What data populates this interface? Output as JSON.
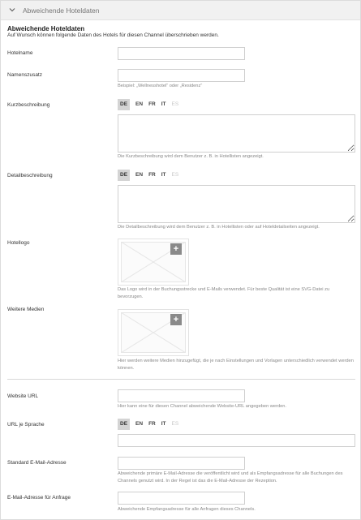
{
  "panel": {
    "title": "Abweichende Hoteldaten"
  },
  "section": {
    "title": "Abweichende Hoteldaten",
    "description": "Auf Wunsch können folgende Daten des Hotels für diesen Channel überschrieben werden."
  },
  "fields": {
    "hotelname": {
      "label": "Hotelname",
      "value": ""
    },
    "namenszusatz": {
      "label": "Namenszusatz",
      "value": "",
      "hint": "Beispiel: „Wellnesshotel“ oder „Residenz“"
    },
    "kurzbeschreibung": {
      "label": "Kurzbeschreibung",
      "hint": "Die Kurzbeschreibung wird dem Benutzer z. B. in Hotellisten angezeigt."
    },
    "detailbeschreibung": {
      "label": "Detailbeschreibung",
      "hint": "Die Detailbeschreibung wird dem Benutzer z. B. in Hotellisten oder auf Hoteldetailseiten angezeigt."
    },
    "hotellogo": {
      "label": "Hotellogo",
      "hint": "Das Logo wird in der Buchungsstrecke und E-Mails verwendet. Für beste Qualität ist eine SVG-Datei zu bevorzugen."
    },
    "weitere_medien": {
      "label": "Weitere Medien",
      "hint": "Hier werden weitere Medien hinzugefügt, die je nach Einstellungen und Vorlagen unterschiedlich verwendet werden können."
    },
    "website_url": {
      "label": "Website URL",
      "value": "",
      "hint": "Hier kann eine für diesen Channel abweichende Website-URL angegeben werden."
    },
    "url_je_sprache": {
      "label": "URL je Sprache",
      "value": ""
    },
    "standard_email": {
      "label": "Standard E-Mail-Adresse",
      "value": "",
      "hint": "Abweichende primäre E-Mail-Adresse die veröffentlicht wird und als Empfangsadresse für alle Buchungen des Channels genutzt wird. In der Regel ist das die E-Mail-Adresse der Rezeption."
    },
    "email_anfrage": {
      "label": "E-Mail-Adresse für Anfrage",
      "value": "",
      "hint": "Abweichende Empfangsadresse für alle Anfragen dieses Channels."
    }
  },
  "languages": [
    "DE",
    "EN",
    "FR",
    "IT",
    "ES"
  ],
  "upload": {
    "plus": "+"
  },
  "icons": {
    "collapse": "chevron-down-icon",
    "add": "plus-icon",
    "placeholder": "image-placeholder-icon"
  }
}
